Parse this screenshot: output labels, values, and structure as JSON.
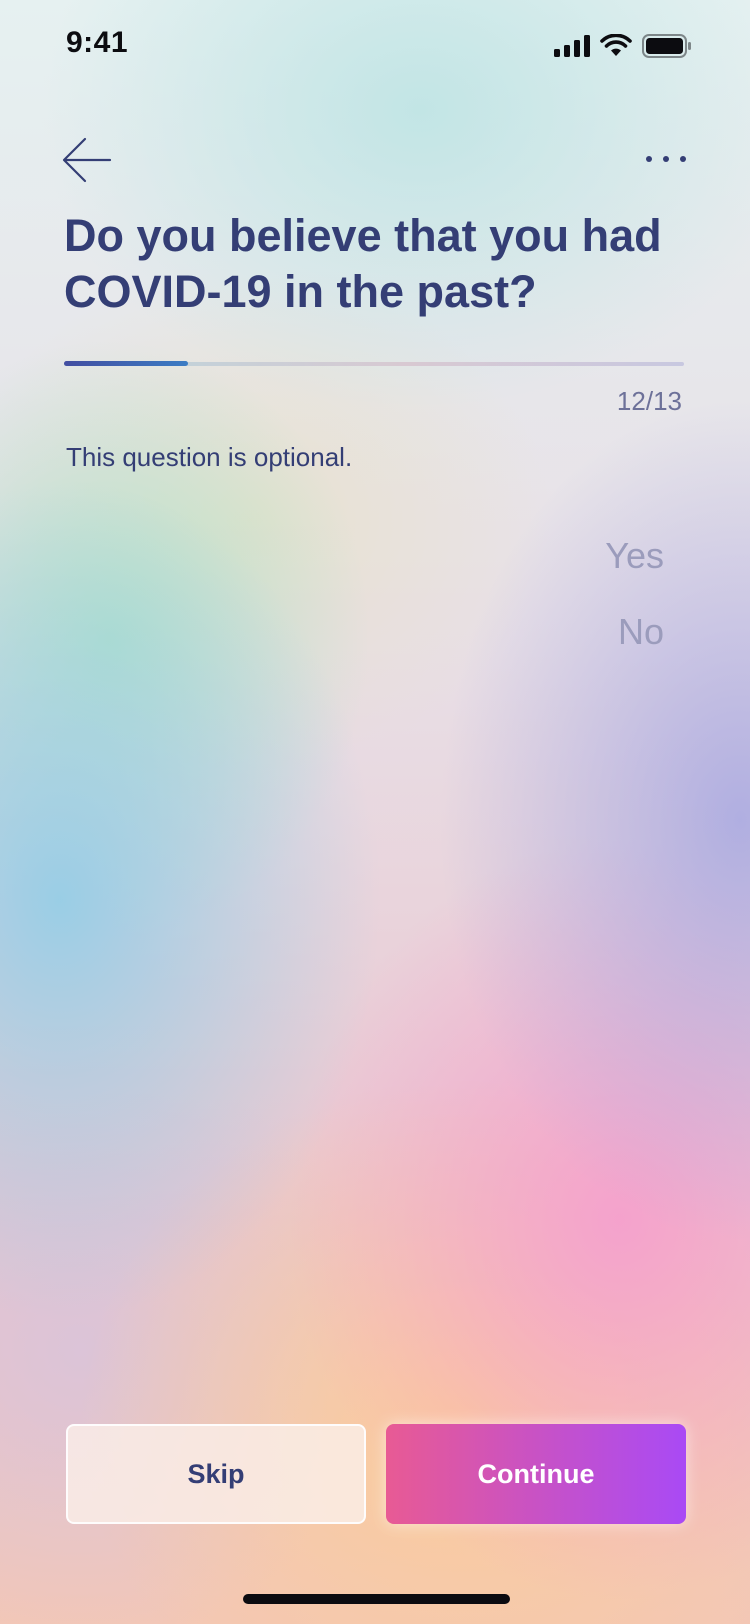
{
  "status_bar": {
    "time": "9:41",
    "signal_icon": "cellular-signal-icon",
    "wifi_icon": "wifi-icon",
    "battery_icon": "battery-icon"
  },
  "nav": {
    "back_icon": "arrow-left-icon",
    "more_icon": "more-horizontal-icon"
  },
  "question": {
    "title": "Do you believe that you had COVID-19 in the past?",
    "progress_current": 12,
    "progress_total": 13,
    "progress_fraction": 0.2,
    "counter_text": "12/13",
    "note": "This question is optional.",
    "options": [
      "Yes",
      "No"
    ]
  },
  "actions": {
    "skip_label": "Skip",
    "continue_label": "Continue"
  },
  "colors": {
    "primary_text": "#343e75",
    "option_text": "#9b9cbc",
    "continue_gradient_start": "#e85a94",
    "continue_gradient_end": "#a94af5"
  }
}
